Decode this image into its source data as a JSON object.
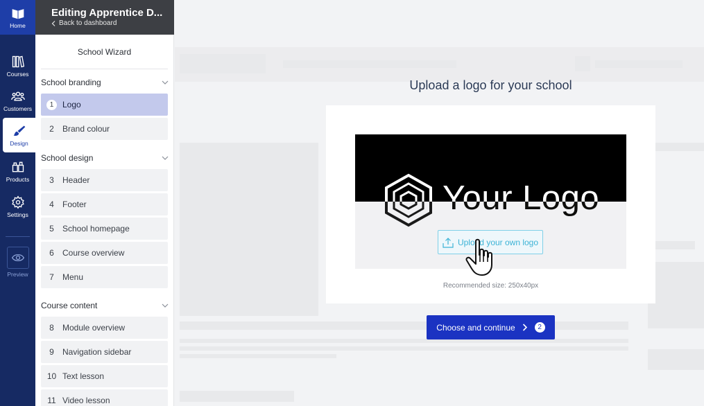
{
  "rail": {
    "home": "Home",
    "courses": "Courses",
    "customers": "Customers",
    "design": "Design",
    "products": "Products",
    "settings": "Settings",
    "preview": "Preview"
  },
  "panel": {
    "title": "Editing Apprentice D...",
    "back": "Back to dashboard",
    "wizard_title": "School Wizard"
  },
  "sections": {
    "branding": "School branding",
    "design": "School design",
    "content": "Course content"
  },
  "steps": [
    {
      "num": "1",
      "label": "Logo",
      "active": true
    },
    {
      "num": "2",
      "label": "Brand colour"
    },
    {
      "num": "3",
      "label": "Header"
    },
    {
      "num": "4",
      "label": "Footer"
    },
    {
      "num": "5",
      "label": "School homepage"
    },
    {
      "num": "6",
      "label": "Course overview"
    },
    {
      "num": "7",
      "label": "Menu"
    },
    {
      "num": "8",
      "label": "Module overview"
    },
    {
      "num": "9",
      "label": "Navigation sidebar"
    },
    {
      "num": "10",
      "label": "Text lesson"
    },
    {
      "num": "11",
      "label": "Video lesson"
    }
  ],
  "main": {
    "title": "Upload a logo for your school",
    "logo_text": "Your Logo",
    "upload_label": "Upload your own logo",
    "recommended": "Recommended size: 250x40px",
    "continue_label": "Choose and continue",
    "continue_badge": "2"
  },
  "colors": {
    "rail": "#162a63",
    "accent": "#1b33c2",
    "active_step": "#c3c9ec",
    "upload_accent": "#3cb3d6"
  }
}
